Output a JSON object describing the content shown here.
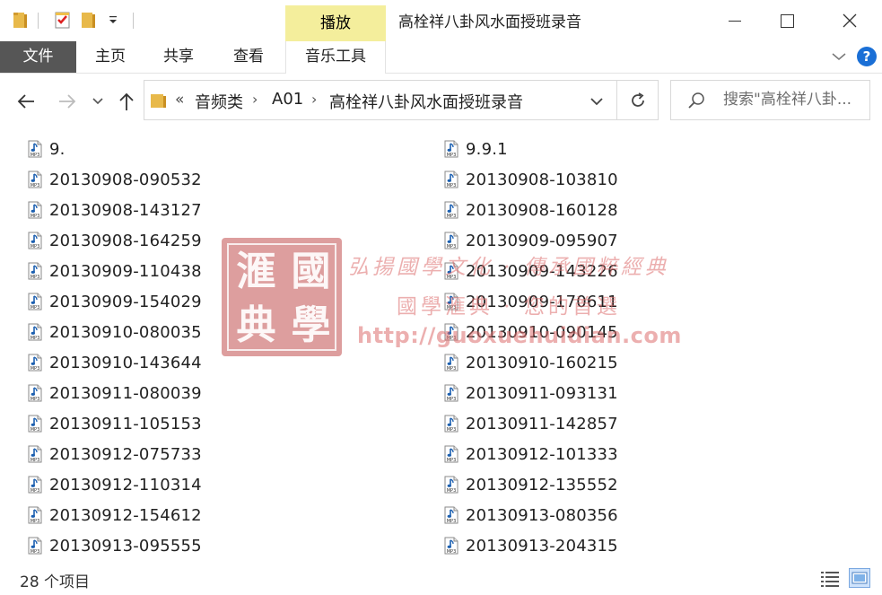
{
  "titlebar": {
    "context_tab": "播放",
    "window_title": "高栓祥八卦风水面授班录音"
  },
  "ribbon": {
    "tabs": [
      {
        "label": "文件"
      },
      {
        "label": "主页"
      },
      {
        "label": "共享"
      },
      {
        "label": "查看"
      },
      {
        "label": "音乐工具"
      }
    ],
    "help": "?"
  },
  "address": {
    "lead": "«",
    "crumbs": [
      "音频类",
      "A01",
      "高栓祥八卦风水面授班录音"
    ],
    "separators": [
      "›",
      "›"
    ]
  },
  "search": {
    "placeholder": "搜索\"高栓祥八卦..."
  },
  "files": {
    "left": [
      "9.",
      "20130908-090532",
      "20130908-143127",
      "20130908-164259",
      "20130909-110438",
      "20130909-154029",
      "20130910-080035",
      "20130910-143644",
      "20130911-080039",
      "20130911-105153",
      "20130912-075733",
      "20130912-110314",
      "20130912-154612",
      "20130913-095555"
    ],
    "right": [
      "9.9.1",
      "20130908-103810",
      "20130908-160128",
      "20130909-095907",
      "20130909-143226",
      "20130909-170611",
      "20130910-090145",
      "20130910-160215",
      "20130911-093131",
      "20130911-142857",
      "20130912-101333",
      "20130912-135552",
      "20130913-080356",
      "20130913-204315"
    ],
    "icon_badge": "MP3"
  },
  "watermark": {
    "seal_chars": [
      "滙",
      "國",
      "典",
      "學"
    ],
    "line1": "弘揚國學文化 · 傳承國粹經典",
    "line2": "國學滙典 · 您的首選",
    "url": "http://guoxuehuidian.com"
  },
  "status": {
    "item_count": "28 个项目"
  },
  "colors": {
    "file_tab": "#565656",
    "context_tab": "#f4ee9c",
    "help": "#1a6fd6",
    "folder": "#e8b94a"
  }
}
